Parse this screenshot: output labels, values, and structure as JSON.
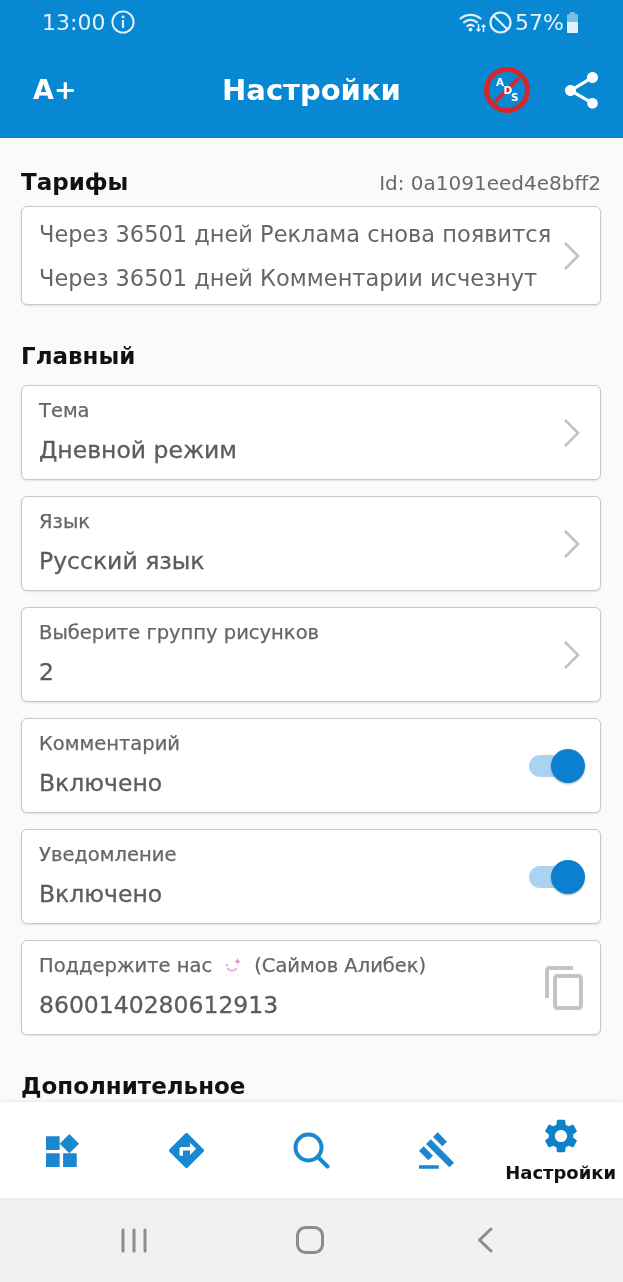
{
  "status_bar": {
    "time": "13:00",
    "battery": "57%"
  },
  "app_bar": {
    "text_size_button": "A+",
    "title": "Настройки",
    "no_ads_button": "ADS"
  },
  "sections": [
    {
      "title": "Тарифы",
      "user_id_text": "Id: 0a1091eed4e8bff2",
      "items": [
        {
          "kind": "info",
          "lines": [
            "Через 36501 дней Реклама снова появится",
            "Через 36501 дней Комментарии исчезнут"
          ]
        }
      ]
    },
    {
      "title": "Главный",
      "items": [
        {
          "kind": "link",
          "label": "Тема",
          "value": "Дневной режим"
        },
        {
          "kind": "link",
          "label": "Язык",
          "value": "Русский язык"
        },
        {
          "kind": "link",
          "label": "Выберите группу рисунков",
          "value": "2"
        },
        {
          "kind": "toggle",
          "label": "Комментарий",
          "value": "Включено",
          "on": true
        },
        {
          "kind": "toggle",
          "label": "Уведомление",
          "value": "Включено",
          "on": true
        },
        {
          "kind": "copy",
          "label": "Поддержите нас",
          "label_note": "(Саймов Алибек)",
          "value": "8600140280612913"
        }
      ]
    },
    {
      "title": "Дополнительное"
    }
  ],
  "bottom_nav": [
    {
      "selected": false
    },
    {
      "selected": false
    },
    {
      "selected": false
    },
    {
      "selected": false
    },
    {
      "selected": true,
      "label": "Настройки"
    }
  ]
}
